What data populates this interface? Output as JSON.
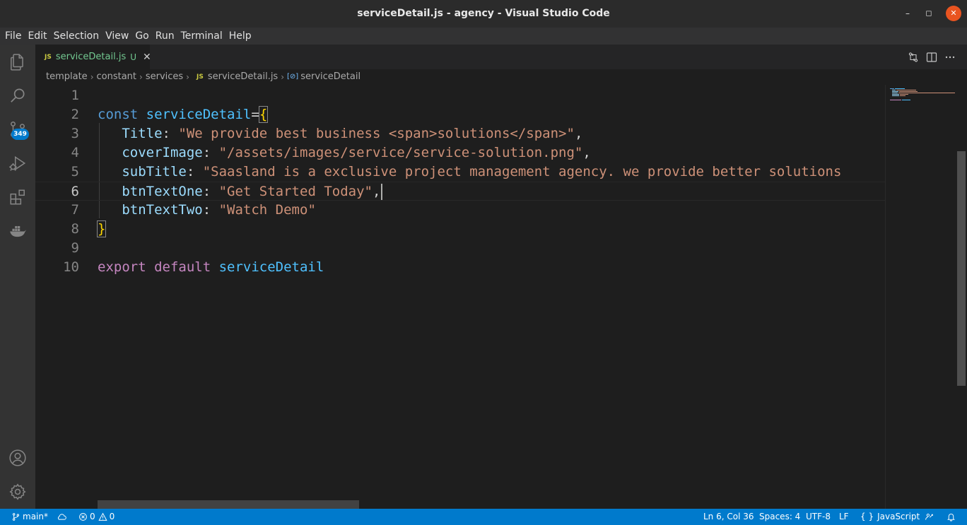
{
  "window": {
    "title": "serviceDetail.js - agency - Visual Studio Code",
    "minimize": "–",
    "maximize": "◻",
    "close": "✕"
  },
  "menu": [
    "File",
    "Edit",
    "Selection",
    "View",
    "Go",
    "Run",
    "Terminal",
    "Help"
  ],
  "activity_bar": {
    "items": [
      "explorer-icon",
      "search-icon",
      "source-control-icon",
      "run-debug-icon",
      "extensions-icon",
      "docker-icon"
    ],
    "bottom_items": [
      "account-icon",
      "settings-gear-icon"
    ],
    "scm_badge": "349"
  },
  "tab": {
    "badge": "JS",
    "name": "serviceDetail.js",
    "status": "U",
    "close": "✕"
  },
  "breadcrumb": {
    "parts": [
      "template",
      "constant",
      "services"
    ],
    "file_badge": "JS",
    "file": "serviceDetail.js",
    "symbol_icon": "[⊘]",
    "symbol": "serviceDetail"
  },
  "editor": {
    "line_numbers": [
      "1",
      "2",
      "3",
      "4",
      "5",
      "6",
      "7",
      "8",
      "9",
      "10"
    ],
    "active_line": 6,
    "lines": [
      [],
      [
        [
          "kw",
          "const "
        ],
        [
          "var",
          "serviceDetail"
        ],
        [
          "plain",
          "="
        ],
        [
          "brace-match",
          "{"
        ]
      ],
      [
        [
          "plain",
          "   "
        ],
        [
          "prop",
          "Title"
        ],
        [
          "plain",
          ": "
        ],
        [
          "str",
          "\"We provide best business <span>solutions</span>\""
        ],
        [
          "plain",
          ","
        ]
      ],
      [
        [
          "plain",
          "   "
        ],
        [
          "prop",
          "coverImage"
        ],
        [
          "plain",
          ": "
        ],
        [
          "str",
          "\"/assets/images/service/service-solution.png\""
        ],
        [
          "plain",
          ","
        ]
      ],
      [
        [
          "plain",
          "   "
        ],
        [
          "prop",
          "subTitle"
        ],
        [
          "plain",
          ": "
        ],
        [
          "str",
          "\"Saasland is a exclusive project management agency. we provide better solutions"
        ]
      ],
      [
        [
          "plain",
          "   "
        ],
        [
          "prop",
          "btnTextOne"
        ],
        [
          "plain",
          ": "
        ],
        [
          "str",
          "\"Get Started Today\""
        ],
        [
          "plain",
          ","
        ]
      ],
      [
        [
          "plain",
          "   "
        ],
        [
          "prop",
          "btnTextTwo"
        ],
        [
          "plain",
          ": "
        ],
        [
          "str",
          "\"Watch Demo\""
        ]
      ],
      [
        [
          "brace-match",
          "}"
        ]
      ],
      [],
      [
        [
          "kw2",
          "export "
        ],
        [
          "kw2",
          "default "
        ],
        [
          "var",
          "serviceDetail"
        ]
      ]
    ]
  },
  "status_bar": {
    "branch": "main*",
    "errors": "0",
    "warnings": "0",
    "cursor": "Ln 6, Col 36",
    "spaces": "Spaces: 4",
    "encoding": "UTF-8",
    "eol": "LF",
    "language_icon": "{ }",
    "language": "JavaScript"
  },
  "colors": {
    "statusbar": "#007acc",
    "titlebar": "#2b2b2b",
    "editor_bg": "#1e1e1e",
    "close_button": "#e95420"
  }
}
